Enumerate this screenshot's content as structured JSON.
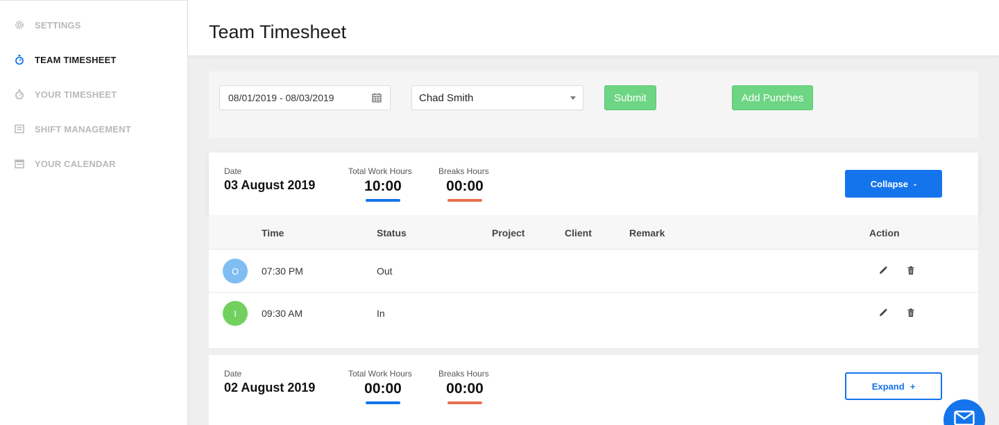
{
  "sidebar": {
    "items": [
      {
        "label": "SETTINGS",
        "icon": "gear-icon",
        "active": false
      },
      {
        "label": "TEAM TIMESHEET",
        "icon": "stopwatch-icon",
        "active": true
      },
      {
        "label": "YOUR TIMESHEET",
        "icon": "stopwatch-icon",
        "active": false
      },
      {
        "label": "SHIFT MANAGEMENT",
        "icon": "list-icon",
        "active": false
      },
      {
        "label": "YOUR CALENDAR",
        "icon": "calendar-icon",
        "active": false
      }
    ]
  },
  "header": {
    "title": "Team Timesheet"
  },
  "filters": {
    "date_range": "08/01/2019 - 08/03/2019",
    "employee": "Chad Smith",
    "submit_label": "Submit",
    "add_punches_label": "Add Punches"
  },
  "labels": {
    "date": "Date",
    "total_work_hours": "Total Work Hours",
    "breaks_hours": "Breaks Hours"
  },
  "columns": [
    "Time",
    "Status",
    "Project",
    "Client",
    "Remark",
    "Action"
  ],
  "days": [
    {
      "date": "03 August 2019",
      "total_work_hours": "10:00",
      "breaks_hours": "00:00",
      "toggle_label": "Collapse",
      "toggle_sign": "-",
      "entries": [
        {
          "initial": "O",
          "time": "07:30 PM",
          "status": "Out",
          "project": "",
          "client": "",
          "remark": ""
        },
        {
          "initial": "I",
          "time": "09:30 AM",
          "status": "In",
          "project": "",
          "client": "",
          "remark": ""
        }
      ]
    },
    {
      "date": "02 August 2019",
      "total_work_hours": "00:00",
      "breaks_hours": "00:00",
      "toggle_label": "Expand",
      "toggle_sign": "+"
    }
  ],
  "colors": {
    "accent_blue": "#1474ec",
    "success_green": "#6ed584",
    "break_orange": "#e8704d",
    "out_avatar": "#7fbdf2",
    "in_avatar": "#72d05f"
  }
}
